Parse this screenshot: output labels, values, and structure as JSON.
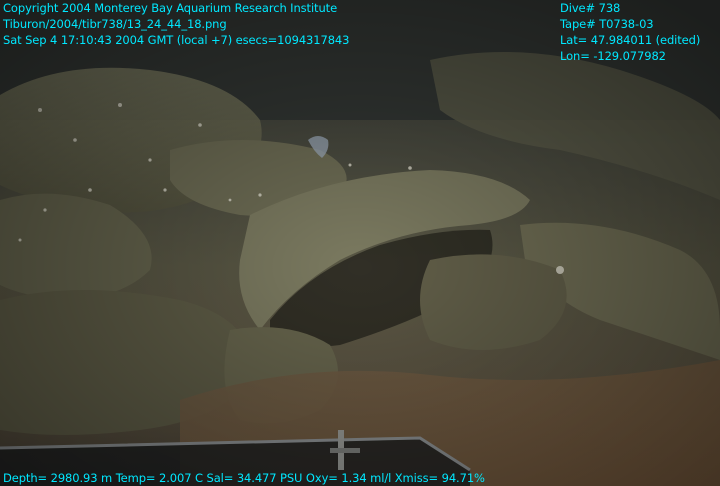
{
  "overlay": {
    "top_left": [
      "Copyright 2004 Monterey Bay Aquarium Research Institute",
      "Tiburon/2004/tibr738/13_24_44_18.png",
      "Sat Sep  4 17:10:43 2004 GMT (local +7)  esecs=1094317843"
    ],
    "top_right": [
      "Dive# 738",
      "Tape# T0738-03",
      "Lat= 47.984011 (edited)",
      "Lon= -129.077982"
    ],
    "bottom": "Depth= 2980.93 m  Temp= 2.007 C  Sal= 34.477 PSU  Oxy= 1.34 ml/l  Xmiss= 94.71%"
  },
  "colors": {
    "overlay_text": "#00e8ff",
    "seafloor": "#5a5845",
    "rock": "#6b6a52",
    "sediment_orange": "#7a5a3c"
  }
}
